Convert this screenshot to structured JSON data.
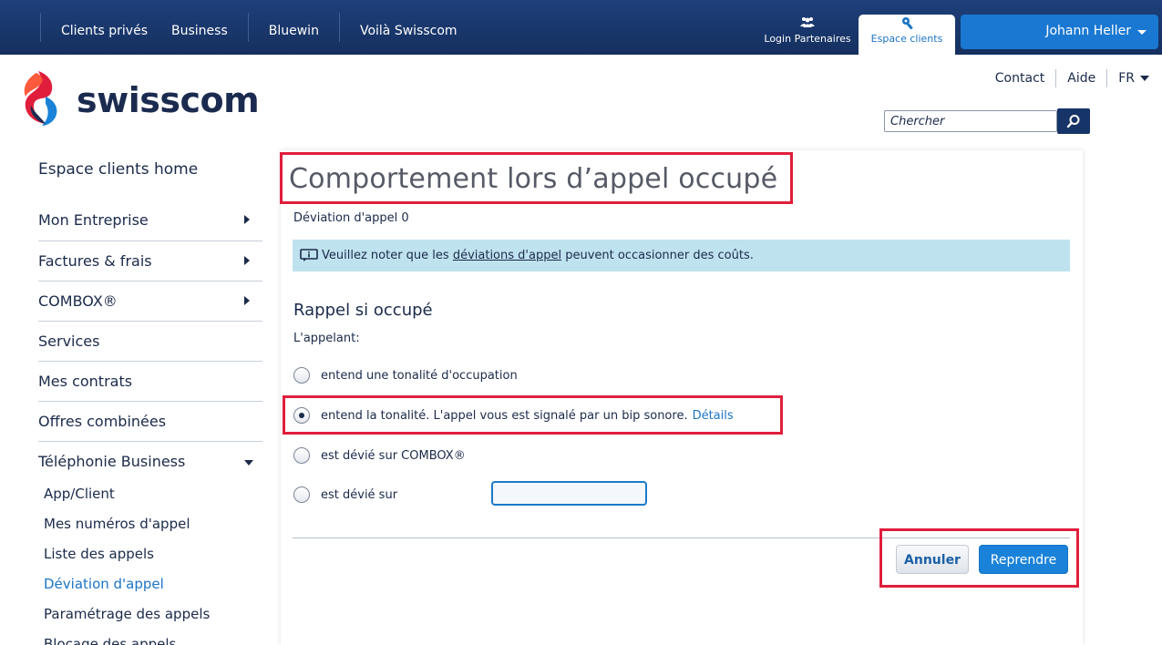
{
  "topnav": {
    "items": [
      "Clients privés",
      "Business",
      "Bluewin",
      "Voilà Swisscom"
    ],
    "partner_label": "Login Partenaires",
    "espace_label": "Espace clients",
    "user_name": "Johann Heller"
  },
  "logo": {
    "wordmark": "swisscom"
  },
  "util": {
    "contact": "Contact",
    "aide": "Aide",
    "lang": "FR"
  },
  "search": {
    "placeholder": "Chercher"
  },
  "sidebar": {
    "home": "Espace clients home",
    "items": [
      {
        "label": "Mon Entreprise",
        "arrow": "right"
      },
      {
        "label": "Factures & frais",
        "arrow": "right"
      },
      {
        "label": "COMBOX®",
        "arrow": "right"
      },
      {
        "label": "Services",
        "arrow": "none"
      },
      {
        "label": "Mes contrats",
        "arrow": "none"
      },
      {
        "label": "Offres combinées",
        "arrow": "none"
      },
      {
        "label": "Téléphonie Business",
        "arrow": "down"
      }
    ],
    "subitems": [
      "App/Client",
      "Mes numéros d'appel",
      "Liste des appels",
      "Déviation d'appel",
      "Paramétrage des appels",
      "Blocage des appels"
    ],
    "active_subitem": "Déviation d'appel"
  },
  "main": {
    "title": "Comportement lors d’appel occupé",
    "subtitle": "Déviation d'appel 0",
    "notice": {
      "prefix": "Veuillez noter que les",
      "link": "déviations d'appel",
      "suffix": "peuvent occasionner des coûts."
    },
    "section_title": "Rappel si occupé",
    "caller_label": "L'appelant:",
    "options": [
      {
        "label": "entend une tonalité d'occupation",
        "checked": false
      },
      {
        "label": "entend la tonalité. L'appel vous est signalé par un bip sonore.",
        "details": "Détails",
        "checked": true
      },
      {
        "label": "est dévié sur COMBOX®",
        "checked": false
      },
      {
        "label": "est dévié sur",
        "checked": false
      }
    ],
    "cancel_label": "Annuler",
    "resume_label": "Reprendre"
  },
  "colors": {
    "nav_bg": "#1e3f7a",
    "accent_blue": "#1a82d8",
    "notice_bg": "#bfe2ef",
    "highlight_red": "#e01e3c"
  }
}
